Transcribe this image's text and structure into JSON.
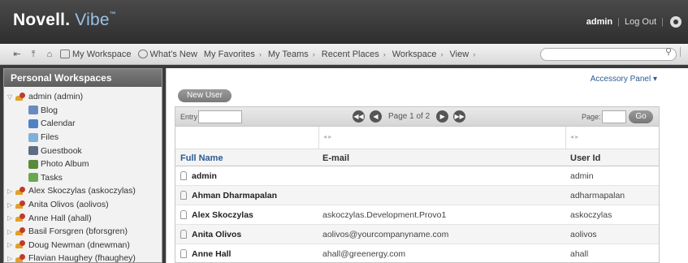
{
  "header": {
    "brand_main": "Novell.",
    "brand_sub": "Vibe",
    "brand_tm": "™",
    "user": "admin",
    "separator": "|",
    "logout": "Log Out",
    "settings_icon": "gear-icon"
  },
  "toolbar": {
    "icons": [
      "pin-icon",
      "up-icon",
      "home-icon"
    ],
    "items": [
      {
        "label": "My Workspace",
        "icon": "workspace-icon"
      },
      {
        "label": "What's New",
        "icon": "whats-new-icon"
      },
      {
        "label": "My Favorites",
        "arrow": "›"
      },
      {
        "label": "My Teams",
        "arrow": "›"
      },
      {
        "label": "Recent Places",
        "arrow": "›"
      },
      {
        "label": "Workspace",
        "arrow": "›"
      },
      {
        "label": "View",
        "arrow": "›"
      }
    ],
    "search_icon": "search-icon"
  },
  "sidebar": {
    "title": "Personal Workspaces",
    "root": "admin (admin)",
    "children": [
      {
        "label": "Blog",
        "color": "#6a8bc0"
      },
      {
        "label": "Calendar",
        "color": "#4e82c4"
      },
      {
        "label": "Files",
        "color": "#7fb0d8"
      },
      {
        "label": "Guestbook",
        "color": "#5e6e82"
      },
      {
        "label": "Photo Album",
        "color": "#5a8a3c"
      },
      {
        "label": "Tasks",
        "color": "#6aa84f"
      }
    ],
    "users": [
      "Alex Skoczylas (askoczylas)",
      "Anita Olivos (aolivos)",
      "Anne Hall (ahall)",
      "Basil Forsgren (bforsgren)",
      "Doug Newman (dnewman)",
      "Flavian Haughey (fhaughey)"
    ]
  },
  "main": {
    "accessory_panel": "Accessory Panel ▾",
    "new_user": "New User",
    "entry_label": "Entry",
    "page_text": "Page 1 of 2",
    "page_label": "Page:",
    "go": "Go",
    "resize_marker": "◂ ▸",
    "columns": {
      "name": "Full Name",
      "email": "E-mail",
      "uid": "User Id"
    },
    "rows": [
      {
        "name": "admin",
        "email": "",
        "uid": "admin"
      },
      {
        "name": "Ahman Dharmapalan",
        "email": "",
        "uid": "adharmapalan"
      },
      {
        "name": "Alex Skoczylas",
        "email": "askoczylas.Development.Provo1",
        "uid": "askoczylas"
      },
      {
        "name": "Anita Olivos",
        "email": "aolivos@yourcompanyname.com",
        "uid": "aolivos"
      },
      {
        "name": "Anne Hall",
        "email": "ahall@greenergy.com",
        "uid": "ahall"
      }
    ]
  }
}
